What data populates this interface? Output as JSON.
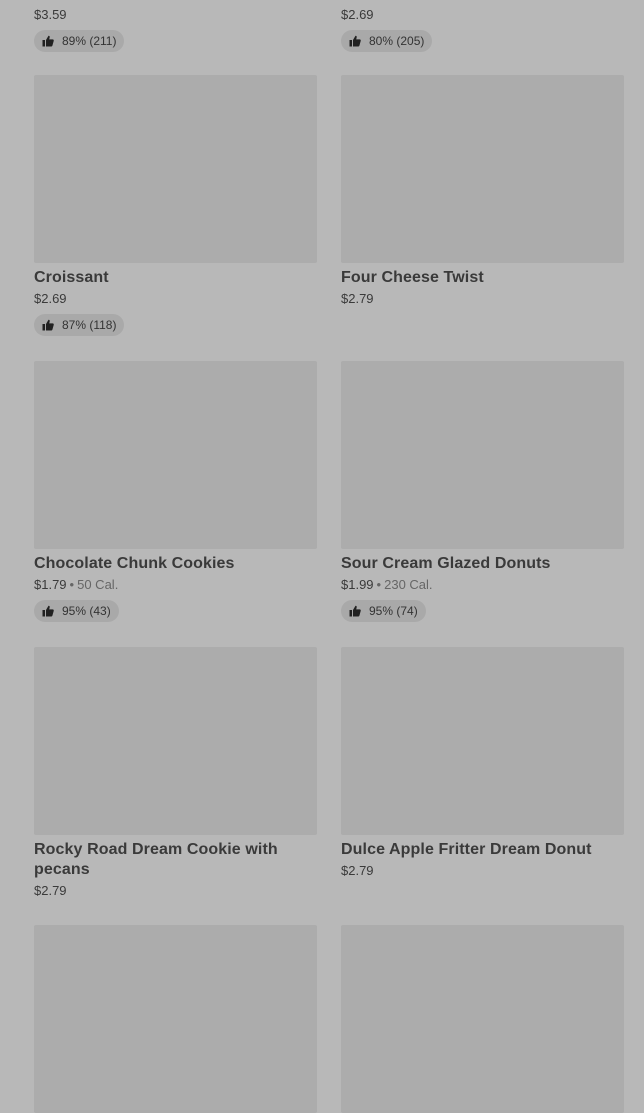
{
  "items": [
    {
      "price": "$3.59",
      "rating": "89% (211)"
    },
    {
      "price": "$2.69",
      "rating": "80% (205)"
    },
    {
      "name": "Croissant",
      "price": "$2.69",
      "rating": "87% (118)"
    },
    {
      "name": "Four Cheese Twist",
      "price": "$2.79"
    },
    {
      "name": "Chocolate Chunk Cookies",
      "price": "$1.79",
      "separator": "•",
      "calories": "50 Cal.",
      "rating": "95% (43)"
    },
    {
      "name": "Sour Cream Glazed Donuts",
      "price": "$1.99",
      "separator": "•",
      "calories": "230 Cal.",
      "rating": "95% (74)"
    },
    {
      "name": "Rocky Road Dream Cookie with pecans",
      "price": "$2.79"
    },
    {
      "name": "Dulce Apple Fritter Dream Donut",
      "price": "$2.79"
    }
  ],
  "icons": {
    "rating": "thumbs-up-icon"
  }
}
